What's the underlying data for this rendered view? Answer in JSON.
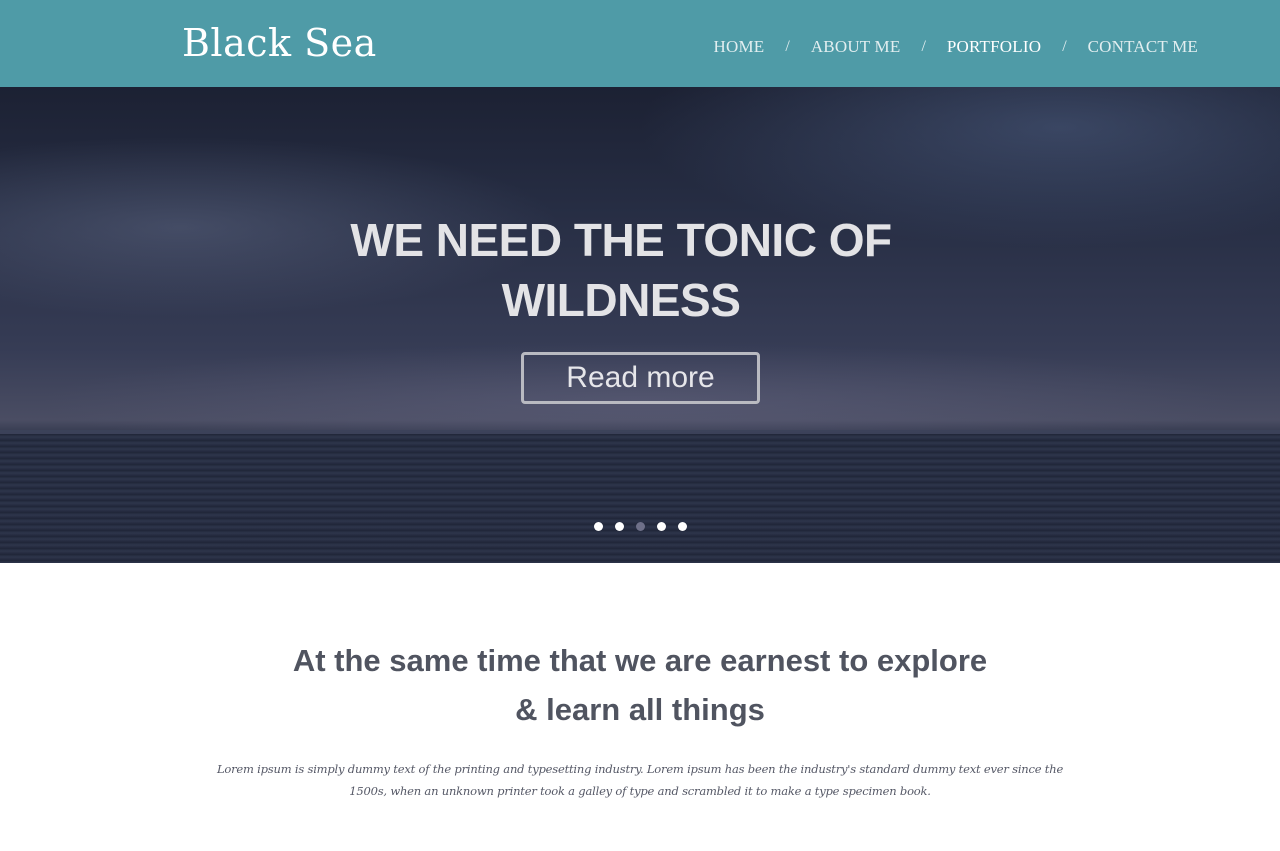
{
  "header": {
    "logo": "Black Sea",
    "nav": [
      {
        "label": "HOME",
        "active": false
      },
      {
        "label": "ABOUT ME",
        "active": false
      },
      {
        "label": "PORTFOLIO",
        "active": true
      },
      {
        "label": "CONTACT ME",
        "active": false
      }
    ],
    "separator": "/",
    "background_color": "#4f9ba7"
  },
  "hero": {
    "title": "WE NEED THE TONIC OF WILDNESS",
    "button_label": "Read more",
    "slide_count": 5,
    "active_slide": 3
  },
  "intro": {
    "heading_line1": "At the same time that we are earnest to explore",
    "heading_amp": "&",
    "heading_line2": "learn all things",
    "body": "Lorem ipsum is simply dummy text of the printing and typesetting industry. Lorem ipsum has been the industry's standard dummy text ever since the 1500s, when an unknown printer took a galley of type and scrambled it to make a type specimen book."
  }
}
